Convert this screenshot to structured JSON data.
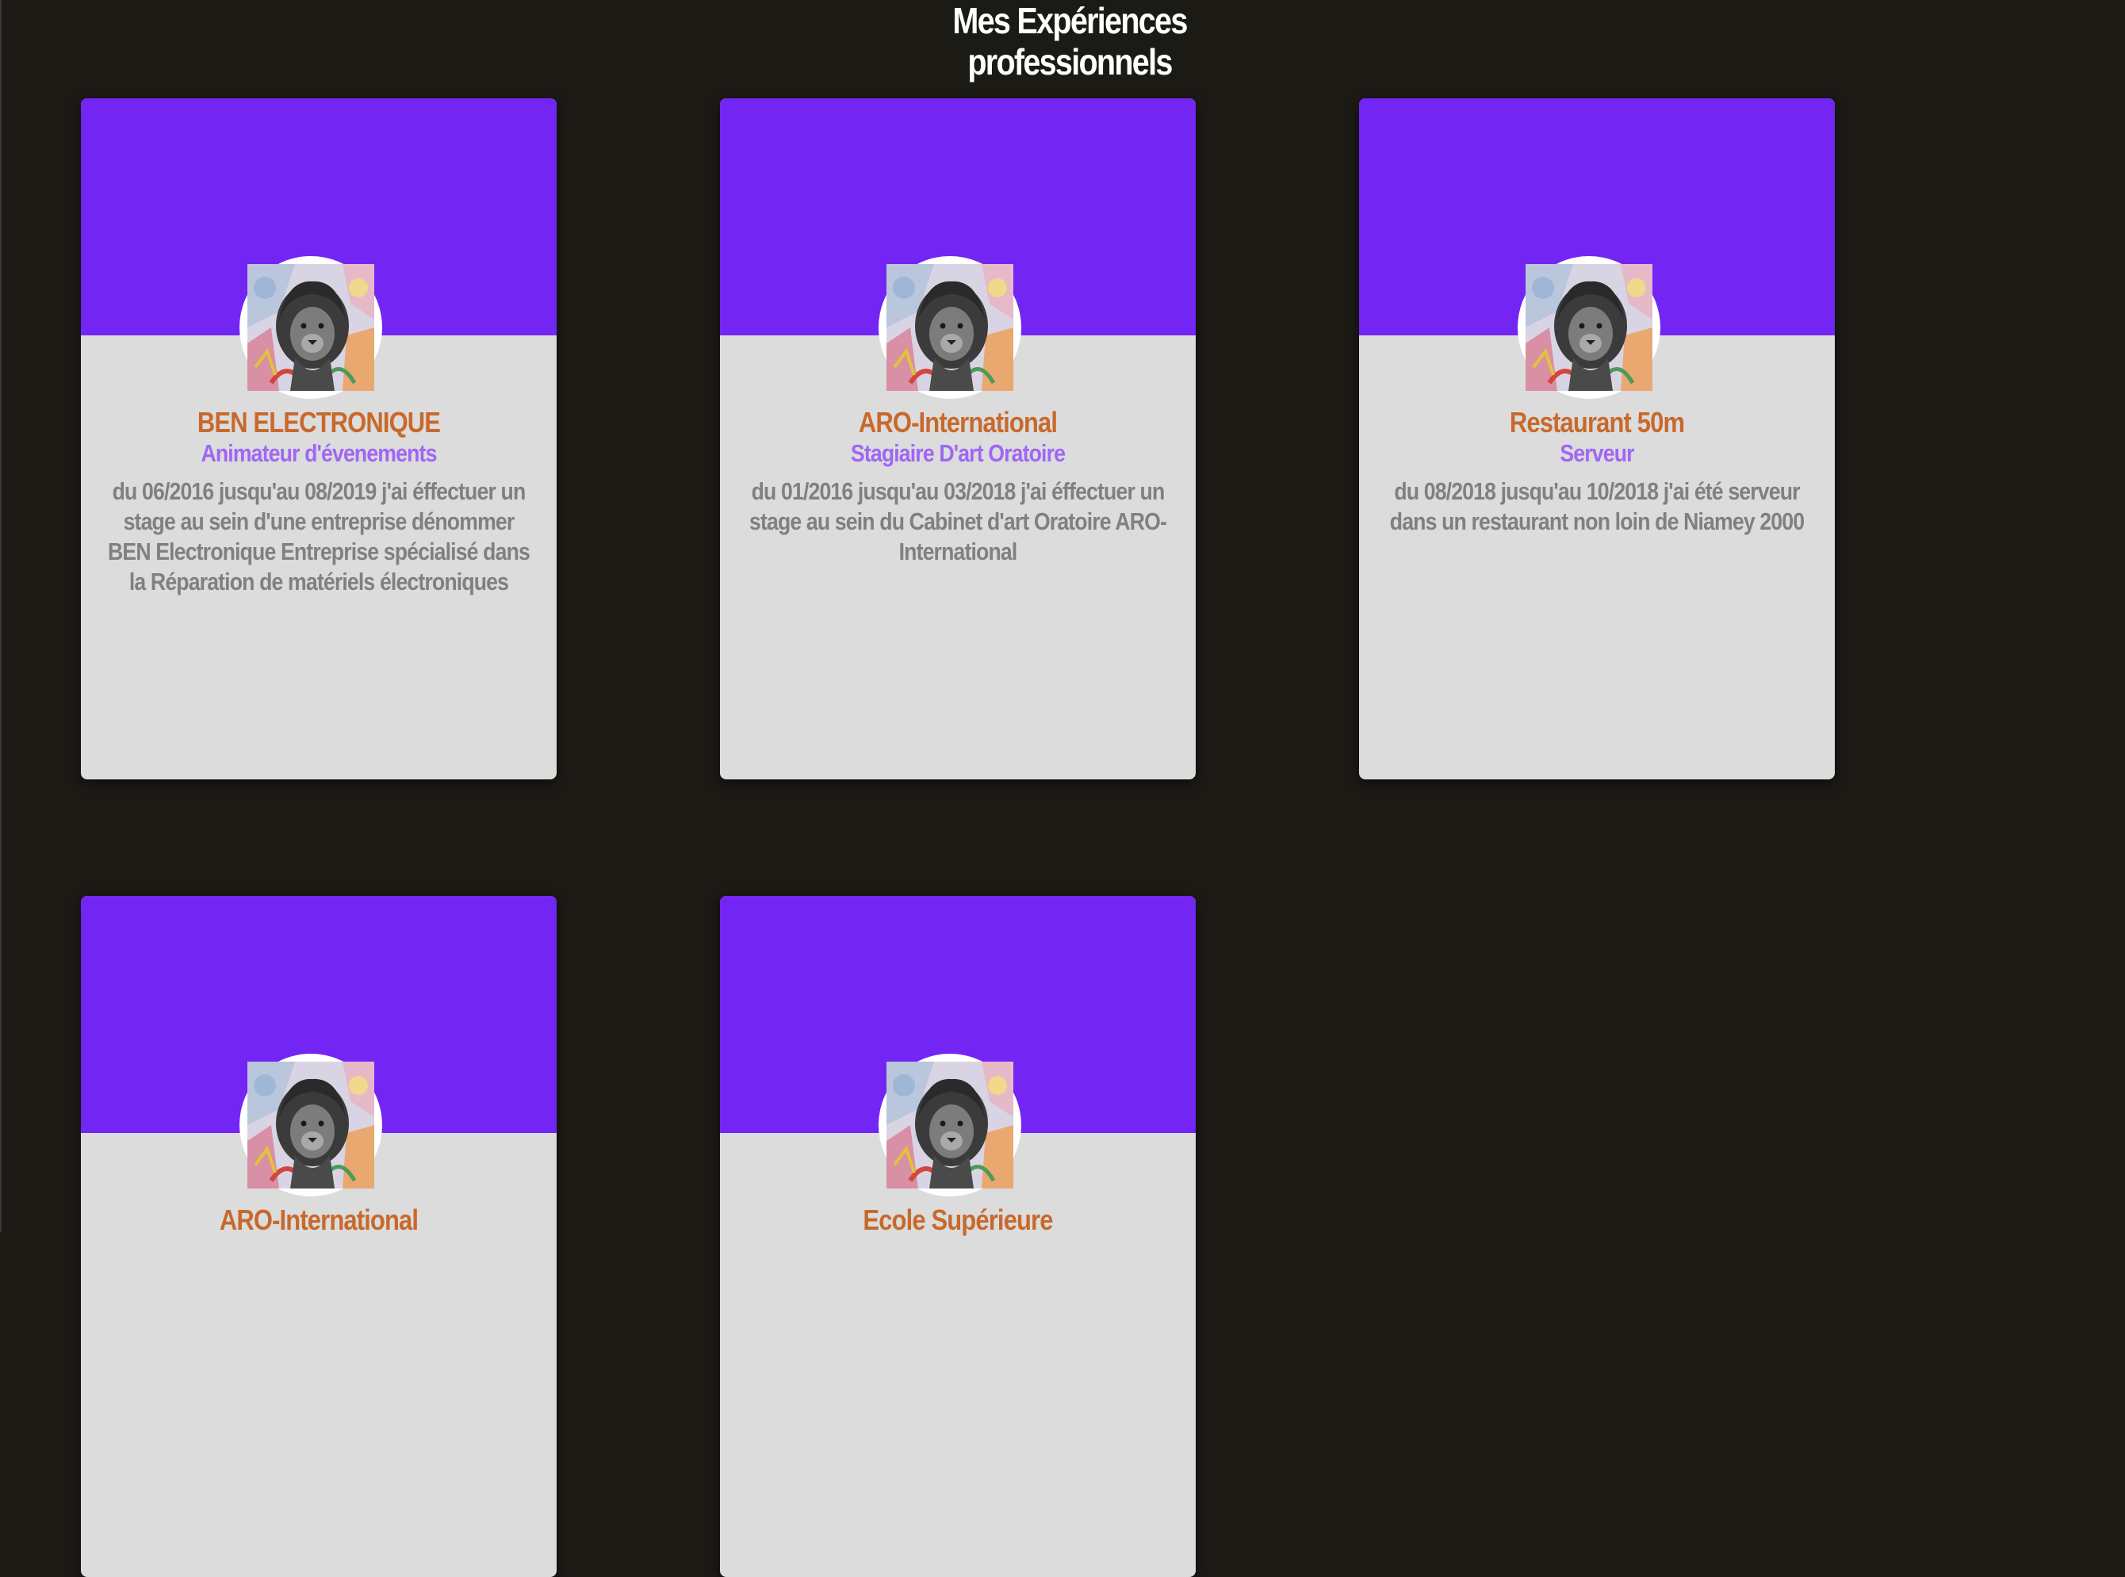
{
  "page": {
    "title": "Mes Expériences professionnels"
  },
  "colors": {
    "background": "#1c1a15",
    "card_header": "#7325f4",
    "card_body": "#dcdcdc",
    "company": "#c8692c",
    "role": "#a066f5",
    "description": "#808080"
  },
  "experiences": [
    {
      "company": "BEN ELECTRONIQUE",
      "role": "Animateur d'évenements",
      "description": "du 06/2016 jusqu'au 08/2019 j'ai éffectuer un stage au sein d'une entreprise dénommer BEN Electronique Entreprise spécialisé dans la Réparation de matériels électroniques",
      "avatar_icon": "lion-portrait-avatar"
    },
    {
      "company": "ARO-International",
      "role": "Stagiaire D'art Oratoire",
      "description": "du 01/2016 jusqu'au 03/2018 j'ai éffectuer un stage au sein du Cabinet d'art Oratoire ARO-International",
      "avatar_icon": "lion-portrait-avatar"
    },
    {
      "company": "Restaurant 50m",
      "role": "Serveur",
      "description": "du 08/2018 jusqu'au 10/2018 j'ai été serveur dans un restaurant non loin de Niamey 2000",
      "avatar_icon": "lion-portrait-avatar"
    },
    {
      "company": "ARO-International",
      "avatar_icon": "lion-portrait-avatar"
    },
    {
      "company": "Ecole Supérieure",
      "avatar_icon": "lion-portrait-avatar"
    }
  ]
}
